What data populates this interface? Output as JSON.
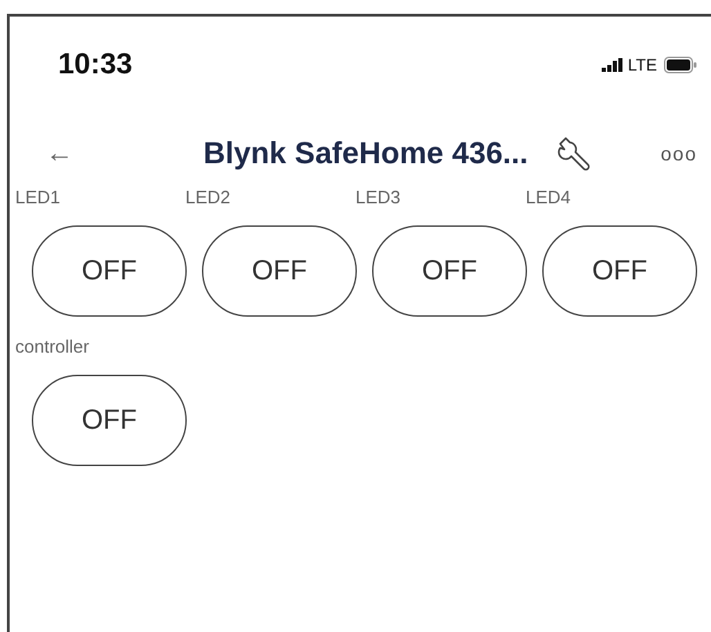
{
  "status_bar": {
    "time": "10:33",
    "network": "LTE"
  },
  "header": {
    "back": "←",
    "title": "Blynk SafeHome 436...",
    "more": "ooo"
  },
  "widgets": [
    {
      "label": "LED1",
      "state_text": "OFF",
      "on": false
    },
    {
      "label": "LED2",
      "state_text": "OFF",
      "on": false
    },
    {
      "label": "LED3",
      "state_text": "OFF",
      "on": false
    },
    {
      "label": "LED4",
      "state_text": "OFF",
      "on": false
    },
    {
      "label": "controller",
      "state_text": "OFF",
      "on": false
    }
  ]
}
